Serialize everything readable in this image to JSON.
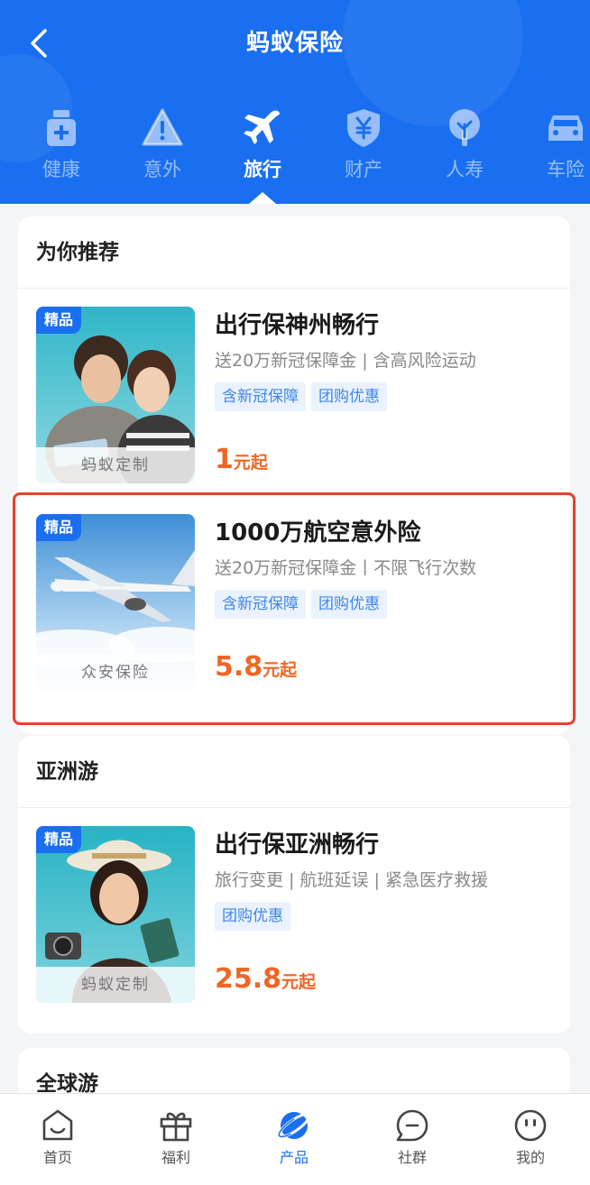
{
  "header": {
    "title": "蚂蚁保险",
    "categories": [
      {
        "label": "健康",
        "icon": "medicine-bottle-icon",
        "active": false
      },
      {
        "label": "意外",
        "icon": "warning-icon",
        "active": false
      },
      {
        "label": "旅行",
        "icon": "airplane-icon",
        "active": true
      },
      {
        "label": "财产",
        "icon": "shield-yen-icon",
        "active": false
      },
      {
        "label": "人寿",
        "icon": "tree-icon",
        "active": false
      },
      {
        "label": "车险",
        "icon": "car-icon",
        "active": false
      }
    ]
  },
  "sections": [
    {
      "title": "为你推荐",
      "products": [
        {
          "badge": "精品",
          "brand": "蚂蚁定制",
          "name": "出行保神州畅行",
          "desc": "送20万新冠保障金 | 含高风险运动",
          "tags": [
            "含新冠保障",
            "团购优惠"
          ],
          "price": "1",
          "price_unit": "元起"
        },
        {
          "badge": "精品",
          "brand": "众安保险",
          "name": "1000万航空意外险",
          "desc": "送20万新冠保障金丨不限飞行次数",
          "tags": [
            "含新冠保障",
            "团购优惠"
          ],
          "price": "5.8",
          "price_unit": "元起"
        }
      ]
    },
    {
      "title": "亚洲游",
      "products": [
        {
          "badge": "精品",
          "brand": "蚂蚁定制",
          "name": "出行保亚洲畅行",
          "desc": "旅行变更 | 航班延误 | 紧急医疗救援",
          "tags": [
            "团购优惠"
          ],
          "price": "25.8",
          "price_unit": "元起"
        }
      ]
    },
    {
      "title": "全球游",
      "products": []
    }
  ],
  "tabbar": [
    {
      "label": "首页",
      "icon": "home-smile-icon",
      "active": false
    },
    {
      "label": "福利",
      "icon": "gift-icon",
      "active": false
    },
    {
      "label": "产品",
      "icon": "planet-icon",
      "active": true
    },
    {
      "label": "社群",
      "icon": "chat-bubble-icon",
      "active": false
    },
    {
      "label": "我的",
      "icon": "face-icon",
      "active": false
    }
  ],
  "colors": {
    "brand_blue": "#1a6ff0",
    "price_orange": "#ef6624",
    "highlight_red": "#e8412c",
    "chip_bg": "#eaf2fd"
  }
}
